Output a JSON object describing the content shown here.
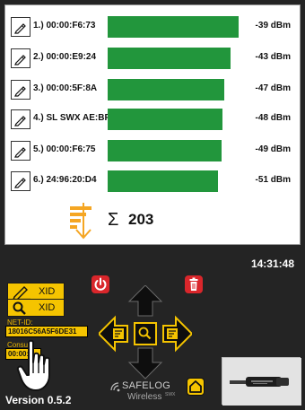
{
  "devices": [
    {
      "label": "1.) 00:00:F6:73",
      "rssi": "-39 dBm",
      "signal_fraction": 0.83
    },
    {
      "label": "2.) 00:00:E9:24",
      "rssi": "-43 dBm",
      "signal_fraction": 0.78
    },
    {
      "label": "3.) 00:00:5F:8A",
      "rssi": "-47 dBm",
      "signal_fraction": 0.74
    },
    {
      "label": "4.) SL SWX AE:BF",
      "rssi": "-48 dBm",
      "signal_fraction": 0.73
    },
    {
      "label": "5.) 00:00:F6:75",
      "rssi": "-49 dBm",
      "signal_fraction": 0.72
    },
    {
      "label": "6.) 24:96:20:D4",
      "rssi": "-51 dBm",
      "signal_fraction": 0.7
    }
  ],
  "summary": {
    "sigma": "Σ",
    "total": "203"
  },
  "clock": "14:31:48",
  "controls": {
    "xid_edit_label": "XID",
    "xid_search_label": "XID",
    "netid_label": "NET-ID:",
    "netid_value": "18016C56A5F6DE31",
    "consumer_label": "Consu",
    "consumer_value": "00:00:"
  },
  "logo": {
    "line1": "SAFELOG",
    "suffix": "SWX",
    "line2": "Wireless"
  },
  "version": "Version 0.5.2",
  "colors": {
    "bar": "#22963c",
    "accent": "#f5c400",
    "alert": "#d9262b",
    "background": "#242424"
  },
  "icons": [
    "edit-icon",
    "sort-icon",
    "down-arrow-icon",
    "pencil-icon",
    "search-icon",
    "power-icon",
    "trash-icon",
    "home-icon",
    "arrow-up-icon",
    "arrow-down-icon",
    "arrow-left-icon",
    "arrow-right-icon",
    "hand-cursor-icon"
  ]
}
